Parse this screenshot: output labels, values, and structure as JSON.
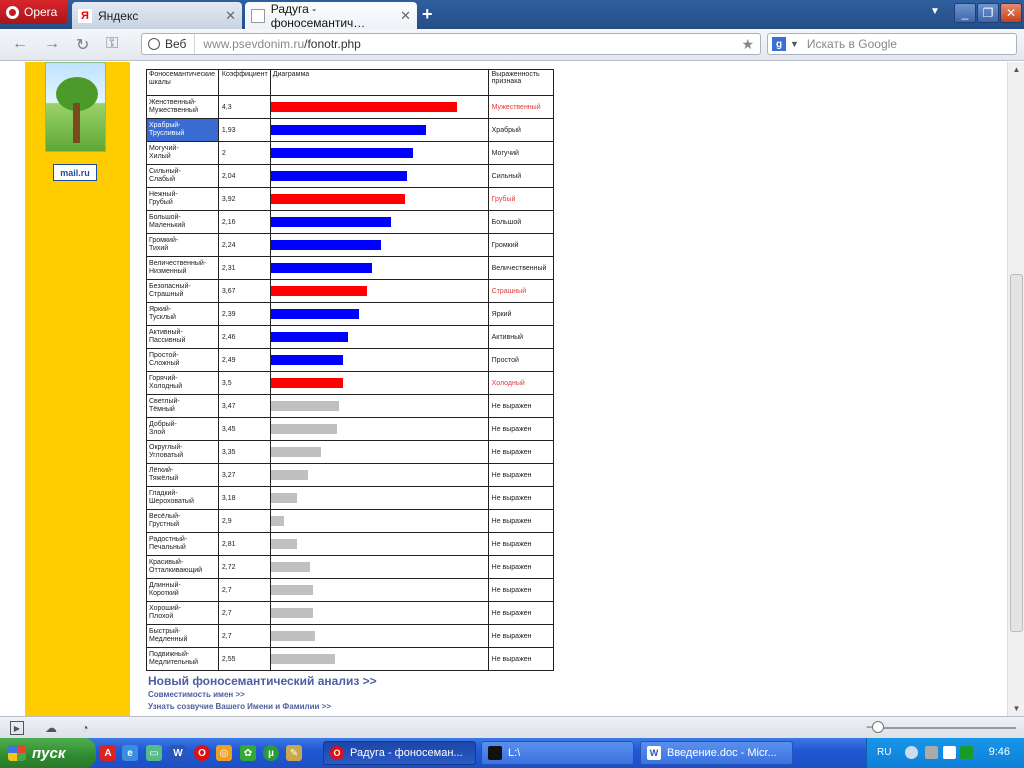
{
  "browser": {
    "menu_label": "Opera",
    "tabs": [
      {
        "title": "Яндекс",
        "favicon": "Я",
        "active": false
      },
      {
        "title": "Радуга - фоносемантич…",
        "active": true
      }
    ],
    "new_tab": "+",
    "address": {
      "badge": "Веб",
      "url_host": "www.psevdonim.ru",
      "url_path": "/fonotr.php"
    },
    "search": {
      "placeholder": "Искать в Google"
    }
  },
  "table": {
    "headers": [
      "Фоносемантические шкалы",
      "Коэффициент",
      "Диаграмма",
      "Выраженность признака"
    ],
    "rows": [
      {
        "s1": "Женственный-",
        "s2": "Мужественный",
        "coef": "4,3",
        "expr": "Мужественный",
        "fill": 0.85,
        "color": "#ff0000",
        "red": true
      },
      {
        "s1": "Храбрый-",
        "s2": "Трусливый",
        "coef": "1,93",
        "expr": "Храбрый",
        "fill": 0.71,
        "color": "#0000ff",
        "red": false,
        "highlight": true
      },
      {
        "s1": "Могучий-",
        "s2": "Хилый",
        "coef": "2",
        "expr": "Могучий",
        "fill": 0.65,
        "color": "#0000ff",
        "red": false
      },
      {
        "s1": "Сильный-",
        "s2": "Слабый",
        "coef": "2,04",
        "expr": "Сильный",
        "fill": 0.62,
        "color": "#0000ff",
        "red": false
      },
      {
        "s1": "Нежный-",
        "s2": "Грубый",
        "coef": "3,92",
        "expr": "Грубый",
        "fill": 0.61,
        "color": "#ff0000",
        "red": true
      },
      {
        "s1": "Большой-",
        "s2": "Маленький",
        "coef": "2,16",
        "expr": "Большой",
        "fill": 0.55,
        "color": "#0000ff",
        "red": false
      },
      {
        "s1": "Громкий-",
        "s2": "Тихий",
        "coef": "2,24",
        "expr": "Громкий",
        "fill": 0.5,
        "color": "#0000ff",
        "red": false
      },
      {
        "s1": "Величественный-",
        "s2": "Низменный",
        "coef": "2,31",
        "expr": "Величественный",
        "fill": 0.46,
        "color": "#0000ff",
        "red": false
      },
      {
        "s1": "Безопасный-",
        "s2": "Страшный",
        "coef": "3,67",
        "expr": "Страшный",
        "fill": 0.44,
        "color": "#ff0000",
        "red": true
      },
      {
        "s1": "Яркий-",
        "s2": "Тусклый",
        "coef": "2,39",
        "expr": "Яркий",
        "fill": 0.4,
        "color": "#0000ff",
        "red": false
      },
      {
        "s1": "Активный-",
        "s2": "Пассивный",
        "coef": "2,46",
        "expr": "Активный",
        "fill": 0.35,
        "color": "#0000ff",
        "red": false
      },
      {
        "s1": "Простой-",
        "s2": "Сложный",
        "coef": "2,49",
        "expr": "Простой",
        "fill": 0.33,
        "color": "#0000ff",
        "red": false
      },
      {
        "s1": "Горячий-",
        "s2": "Холодный",
        "coef": "3,5",
        "expr": "Холодный",
        "fill": 0.33,
        "color": "#ff0000",
        "red": true
      },
      {
        "s1": "Светлый-",
        "s2": "Тёмный",
        "coef": "3,47",
        "expr": "Не выражен",
        "fill": 0.31,
        "color": "#c0c0c0",
        "red": false
      },
      {
        "s1": "Добрый-",
        "s2": "Злой",
        "coef": "3,45",
        "expr": "Не выражен",
        "fill": 0.3,
        "color": "#c0c0c0",
        "red": false
      },
      {
        "s1": "Округлый-",
        "s2": "Угловатый",
        "coef": "3,35",
        "expr": "Не выражен",
        "fill": 0.23,
        "color": "#c0c0c0",
        "red": false
      },
      {
        "s1": "Лёгкий-",
        "s2": "Тяжёлый",
        "coef": "3,27",
        "expr": "Не выражен",
        "fill": 0.17,
        "color": "#c0c0c0",
        "red": false
      },
      {
        "s1": "Гладкий-",
        "s2": "Шероховатый",
        "coef": "3,18",
        "expr": "Не выражен",
        "fill": 0.12,
        "color": "#c0c0c0",
        "red": false
      },
      {
        "s1": "Весёлый-",
        "s2": "Грустный",
        "coef": "2,9",
        "expr": "Не выражен",
        "fill": 0.06,
        "color": "#c0c0c0",
        "red": false
      },
      {
        "s1": "Радостный-",
        "s2": "Печальный",
        "coef": "2,81",
        "expr": "Не выражен",
        "fill": 0.12,
        "color": "#c0c0c0",
        "red": false
      },
      {
        "s1": "Красивый-",
        "s2": "Отталкивающий",
        "coef": "2,72",
        "expr": "Не выражен",
        "fill": 0.18,
        "color": "#c0c0c0",
        "red": false
      },
      {
        "s1": "Длинный-",
        "s2": "Короткий",
        "coef": "2,7",
        "expr": "Не выражен",
        "fill": 0.19,
        "color": "#c0c0c0",
        "red": false
      },
      {
        "s1": "Хороший-",
        "s2": "Плохой",
        "coef": "2,7",
        "expr": "Не выражен",
        "fill": 0.19,
        "color": "#c0c0c0",
        "red": false
      },
      {
        "s1": "Быстрый-",
        "s2": "Медленный",
        "coef": "2,7",
        "expr": "Не выражен",
        "fill": 0.2,
        "color": "#c0c0c0",
        "red": false
      },
      {
        "s1": "Подвижный-",
        "s2": "Медлительный",
        "coef": "2,55",
        "expr": "Не выражен",
        "fill": 0.29,
        "color": "#c0c0c0",
        "red": false
      }
    ]
  },
  "links": {
    "new_analysis": "Новый фоносемантический анализ >>",
    "compat": "Совместимость имен >>",
    "consonance": "Узнать созвучие Вашего Имени и Фамилии >>"
  },
  "sidebar": {
    "mailru": "mail.ru"
  },
  "taskbar": {
    "start": "пуск",
    "tasks": [
      "Радуга - фоносеман...",
      "L:\\",
      "Введение.doc - Micr..."
    ],
    "lang": "RU",
    "clock": "9:46"
  }
}
